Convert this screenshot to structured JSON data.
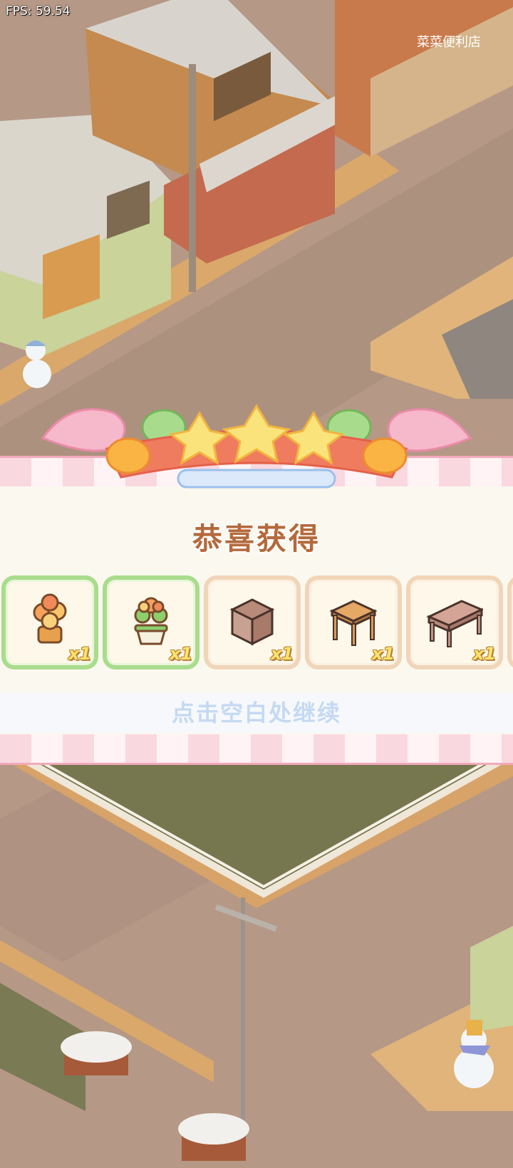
{
  "hud": {
    "fps_text": "FPS: 59.54"
  },
  "scene": {
    "store_sign": "菜菜便利店"
  },
  "reward": {
    "title": "恭喜获得",
    "hint": "点击空白处继续",
    "items": [
      {
        "icon": "orange-flower-pot-icon",
        "qty": "x1",
        "frame": "green"
      },
      {
        "icon": "green-flower-pot-icon",
        "qty": "x1",
        "frame": "green"
      },
      {
        "icon": "cabinet-icon",
        "qty": "x1",
        "frame": "tan"
      },
      {
        "icon": "stool-icon",
        "qty": "x1",
        "frame": "tan"
      },
      {
        "icon": "desk-icon",
        "qty": "x1",
        "frame": "tan"
      }
    ]
  },
  "colors": {
    "title": "#b46a3c",
    "hint": "#c5d9f2",
    "qty": "#ffe36b",
    "green_frame": "#a9dc8d",
    "tan_frame": "#f1d5b8",
    "stripe_pink": "#fad8e0"
  }
}
